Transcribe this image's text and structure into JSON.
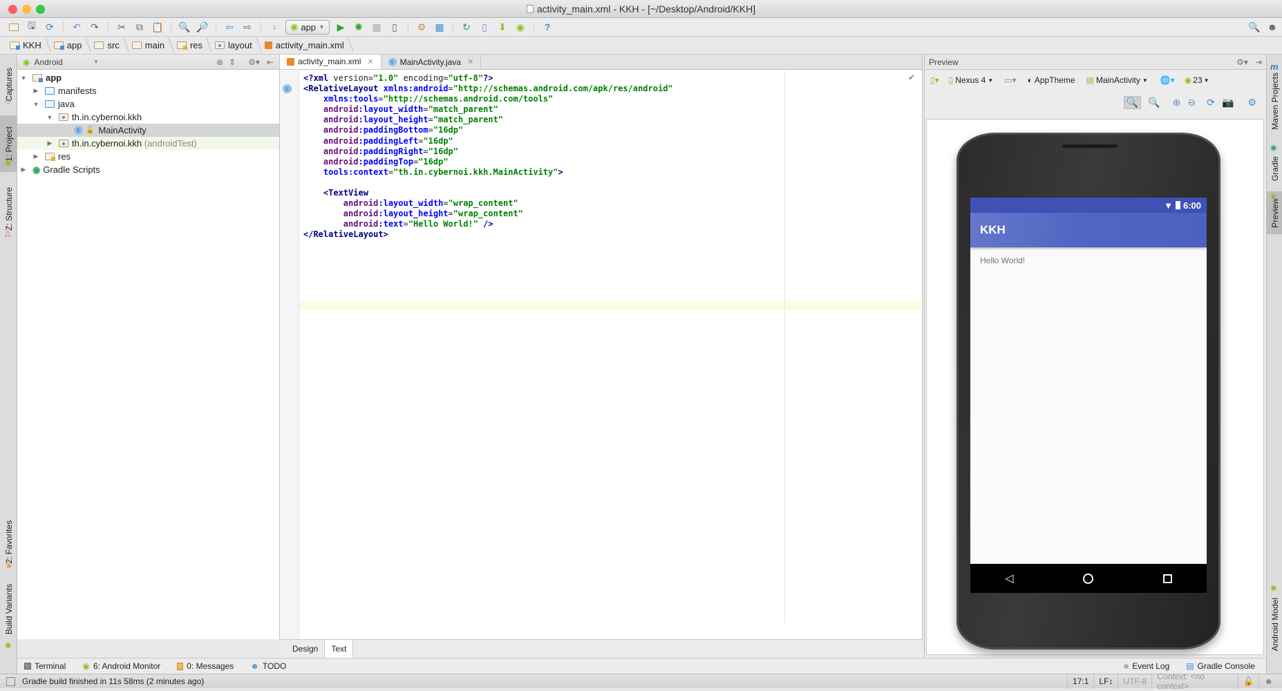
{
  "window": {
    "title": "activity_main.xml - KKH - [~/Desktop/Android/KKH]",
    "traffic_lights": {
      "close": "#fc605c",
      "minimize": "#fdbc40",
      "zoom": "#34c84a"
    }
  },
  "toolbar": {
    "icons": [
      "open-icon",
      "save-icon",
      "sync-icon",
      "undo-icon",
      "redo-icon",
      "cut-icon",
      "copy-icon",
      "paste-icon",
      "find-icon",
      "replace-icon",
      "back-icon",
      "forward-icon",
      "make-project-icon"
    ],
    "run_config": "app",
    "run_icons": [
      "run-icon",
      "debug-icon",
      "coverage-icon",
      "attach-debugger-icon",
      "project-structure-icon",
      "sdk-manager-icon",
      "sync-gradle-icon",
      "avd-manager-icon",
      "sdk-download-icon",
      "android-device-monitor-icon",
      "help-icon"
    ],
    "search_icon": "search-icon",
    "account_icon": "user-icon"
  },
  "breadcrumb": [
    "KKH",
    "app",
    "src",
    "main",
    "res",
    "layout",
    "activity_main.xml"
  ],
  "left_stripe": {
    "top": [
      {
        "label": "Captures",
        "icon": "captures-icon"
      },
      {
        "label": "1: Project",
        "icon": "android-icon",
        "active": true
      },
      {
        "label": "Z: Structure",
        "icon": "structure-icon"
      }
    ],
    "bottom": [
      {
        "label": "2: Favorites",
        "icon": "star-icon"
      },
      {
        "label": "Build Variants",
        "icon": "android-icon"
      }
    ]
  },
  "right_stripe": [
    {
      "label": "Maven Projects",
      "icon": "maven-icon"
    },
    {
      "label": "Gradle",
      "icon": "gradle-icon"
    },
    {
      "label": "Preview",
      "icon": "preview-icon",
      "active": true
    },
    {
      "label": "Android Model",
      "icon": "android-icon"
    }
  ],
  "project": {
    "view_selector": "Android",
    "tree": [
      {
        "label": "app",
        "depth": 0,
        "expanded": true,
        "bold": true,
        "icon": "module-folder"
      },
      {
        "label": "manifests",
        "depth": 1,
        "expanded": false,
        "icon": "folder"
      },
      {
        "label": "java",
        "depth": 1,
        "expanded": true,
        "icon": "folder"
      },
      {
        "label": "th.in.cybernoi.kkh",
        "depth": 2,
        "expanded": true,
        "icon": "package"
      },
      {
        "label": "MainActivity",
        "depth": 3,
        "selected": true,
        "icon": "class"
      },
      {
        "label": "th.in.cybernoi.kkh",
        "suffix": "(androidTest)",
        "depth": 2,
        "expanded": false,
        "icon": "package"
      },
      {
        "label": "res",
        "depth": 1,
        "expanded": false,
        "icon": "res-folder"
      },
      {
        "label": "Gradle Scripts",
        "depth": 0,
        "expanded": false,
        "icon": "gradle"
      }
    ]
  },
  "editor": {
    "tabs": [
      {
        "label": "activity_main.xml",
        "active": true
      },
      {
        "label": "MainActivity.java",
        "active": false
      }
    ],
    "lines": [
      "<?xml version=\"1.0\" encoding=\"utf-8\"?>",
      "<RelativeLayout xmlns:android=\"http://schemas.android.com/apk/res/android\"",
      "    xmlns:tools=\"http://schemas.android.com/tools\"",
      "    android:layout_width=\"match_parent\"",
      "    android:layout_height=\"match_parent\"",
      "    android:paddingBottom=\"16dp\"",
      "    android:paddingLeft=\"16dp\"",
      "    android:paddingRight=\"16dp\"",
      "    android:paddingTop=\"16dp\"",
      "    tools:context=\"th.in.cybernoi.kkh.MainActivity\">",
      "",
      "    <TextView",
      "        android:layout_width=\"wrap_content\"",
      "        android:layout_height=\"wrap_content\"",
      "        android:text=\"Hello World!\" />",
      "</RelativeLayout>"
    ],
    "bottom_tabs": [
      {
        "label": "Design",
        "active": false
      },
      {
        "label": "Text",
        "active": true
      }
    ]
  },
  "preview": {
    "title": "Preview",
    "device": "Nexus 4",
    "theme": "AppTheme",
    "activity": "MainActivity",
    "api_level": "23",
    "phone": {
      "status_time": "6:00",
      "app_title": "KKH",
      "content_text": "Hello World!",
      "colors": {
        "status_bar": "#3f51b5",
        "action_bar": "#4f67c2"
      }
    }
  },
  "tool_windows": {
    "left": [
      {
        "label": "Terminal",
        "icon": "terminal-icon"
      },
      {
        "label": "6: Android Monitor",
        "icon": "android-icon"
      },
      {
        "label": "0: Messages",
        "icon": "messages-icon"
      },
      {
        "label": "TODO",
        "icon": "todo-icon"
      }
    ],
    "right": [
      {
        "label": "Event Log",
        "icon": "event-log-icon"
      },
      {
        "label": "Gradle Console",
        "icon": "gradle-console-icon"
      }
    ]
  },
  "statusbar": {
    "message": "Gradle build finished in 11s 58ms (2 minutes ago)",
    "position": "17:1",
    "line_sep": "LF↕",
    "encoding": "UTF-8",
    "context": "Context: <no context>"
  }
}
